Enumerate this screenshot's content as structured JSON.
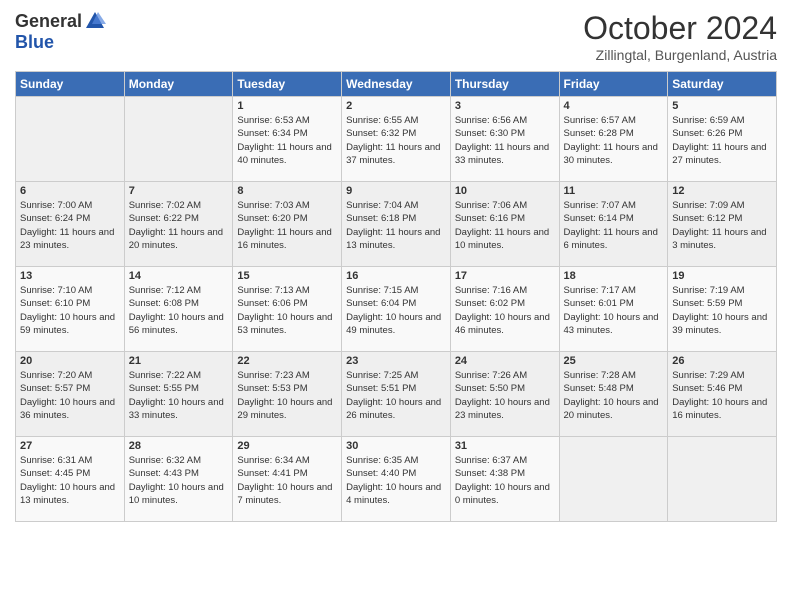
{
  "logo": {
    "general": "General",
    "blue": "Blue"
  },
  "title": "October 2024",
  "location": "Zillingtal, Burgenland, Austria",
  "days_of_week": [
    "Sunday",
    "Monday",
    "Tuesday",
    "Wednesday",
    "Thursday",
    "Friday",
    "Saturday"
  ],
  "weeks": [
    [
      {
        "num": "",
        "detail": ""
      },
      {
        "num": "",
        "detail": ""
      },
      {
        "num": "1",
        "detail": "Sunrise: 6:53 AM\nSunset: 6:34 PM\nDaylight: 11 hours and 40 minutes."
      },
      {
        "num": "2",
        "detail": "Sunrise: 6:55 AM\nSunset: 6:32 PM\nDaylight: 11 hours and 37 minutes."
      },
      {
        "num": "3",
        "detail": "Sunrise: 6:56 AM\nSunset: 6:30 PM\nDaylight: 11 hours and 33 minutes."
      },
      {
        "num": "4",
        "detail": "Sunrise: 6:57 AM\nSunset: 6:28 PM\nDaylight: 11 hours and 30 minutes."
      },
      {
        "num": "5",
        "detail": "Sunrise: 6:59 AM\nSunset: 6:26 PM\nDaylight: 11 hours and 27 minutes."
      }
    ],
    [
      {
        "num": "6",
        "detail": "Sunrise: 7:00 AM\nSunset: 6:24 PM\nDaylight: 11 hours and 23 minutes."
      },
      {
        "num": "7",
        "detail": "Sunrise: 7:02 AM\nSunset: 6:22 PM\nDaylight: 11 hours and 20 minutes."
      },
      {
        "num": "8",
        "detail": "Sunrise: 7:03 AM\nSunset: 6:20 PM\nDaylight: 11 hours and 16 minutes."
      },
      {
        "num": "9",
        "detail": "Sunrise: 7:04 AM\nSunset: 6:18 PM\nDaylight: 11 hours and 13 minutes."
      },
      {
        "num": "10",
        "detail": "Sunrise: 7:06 AM\nSunset: 6:16 PM\nDaylight: 11 hours and 10 minutes."
      },
      {
        "num": "11",
        "detail": "Sunrise: 7:07 AM\nSunset: 6:14 PM\nDaylight: 11 hours and 6 minutes."
      },
      {
        "num": "12",
        "detail": "Sunrise: 7:09 AM\nSunset: 6:12 PM\nDaylight: 11 hours and 3 minutes."
      }
    ],
    [
      {
        "num": "13",
        "detail": "Sunrise: 7:10 AM\nSunset: 6:10 PM\nDaylight: 10 hours and 59 minutes."
      },
      {
        "num": "14",
        "detail": "Sunrise: 7:12 AM\nSunset: 6:08 PM\nDaylight: 10 hours and 56 minutes."
      },
      {
        "num": "15",
        "detail": "Sunrise: 7:13 AM\nSunset: 6:06 PM\nDaylight: 10 hours and 53 minutes."
      },
      {
        "num": "16",
        "detail": "Sunrise: 7:15 AM\nSunset: 6:04 PM\nDaylight: 10 hours and 49 minutes."
      },
      {
        "num": "17",
        "detail": "Sunrise: 7:16 AM\nSunset: 6:02 PM\nDaylight: 10 hours and 46 minutes."
      },
      {
        "num": "18",
        "detail": "Sunrise: 7:17 AM\nSunset: 6:01 PM\nDaylight: 10 hours and 43 minutes."
      },
      {
        "num": "19",
        "detail": "Sunrise: 7:19 AM\nSunset: 5:59 PM\nDaylight: 10 hours and 39 minutes."
      }
    ],
    [
      {
        "num": "20",
        "detail": "Sunrise: 7:20 AM\nSunset: 5:57 PM\nDaylight: 10 hours and 36 minutes."
      },
      {
        "num": "21",
        "detail": "Sunrise: 7:22 AM\nSunset: 5:55 PM\nDaylight: 10 hours and 33 minutes."
      },
      {
        "num": "22",
        "detail": "Sunrise: 7:23 AM\nSunset: 5:53 PM\nDaylight: 10 hours and 29 minutes."
      },
      {
        "num": "23",
        "detail": "Sunrise: 7:25 AM\nSunset: 5:51 PM\nDaylight: 10 hours and 26 minutes."
      },
      {
        "num": "24",
        "detail": "Sunrise: 7:26 AM\nSunset: 5:50 PM\nDaylight: 10 hours and 23 minutes."
      },
      {
        "num": "25",
        "detail": "Sunrise: 7:28 AM\nSunset: 5:48 PM\nDaylight: 10 hours and 20 minutes."
      },
      {
        "num": "26",
        "detail": "Sunrise: 7:29 AM\nSunset: 5:46 PM\nDaylight: 10 hours and 16 minutes."
      }
    ],
    [
      {
        "num": "27",
        "detail": "Sunrise: 6:31 AM\nSunset: 4:45 PM\nDaylight: 10 hours and 13 minutes."
      },
      {
        "num": "28",
        "detail": "Sunrise: 6:32 AM\nSunset: 4:43 PM\nDaylight: 10 hours and 10 minutes."
      },
      {
        "num": "29",
        "detail": "Sunrise: 6:34 AM\nSunset: 4:41 PM\nDaylight: 10 hours and 7 minutes."
      },
      {
        "num": "30",
        "detail": "Sunrise: 6:35 AM\nSunset: 4:40 PM\nDaylight: 10 hours and 4 minutes."
      },
      {
        "num": "31",
        "detail": "Sunrise: 6:37 AM\nSunset: 4:38 PM\nDaylight: 10 hours and 0 minutes."
      },
      {
        "num": "",
        "detail": ""
      },
      {
        "num": "",
        "detail": ""
      }
    ]
  ]
}
